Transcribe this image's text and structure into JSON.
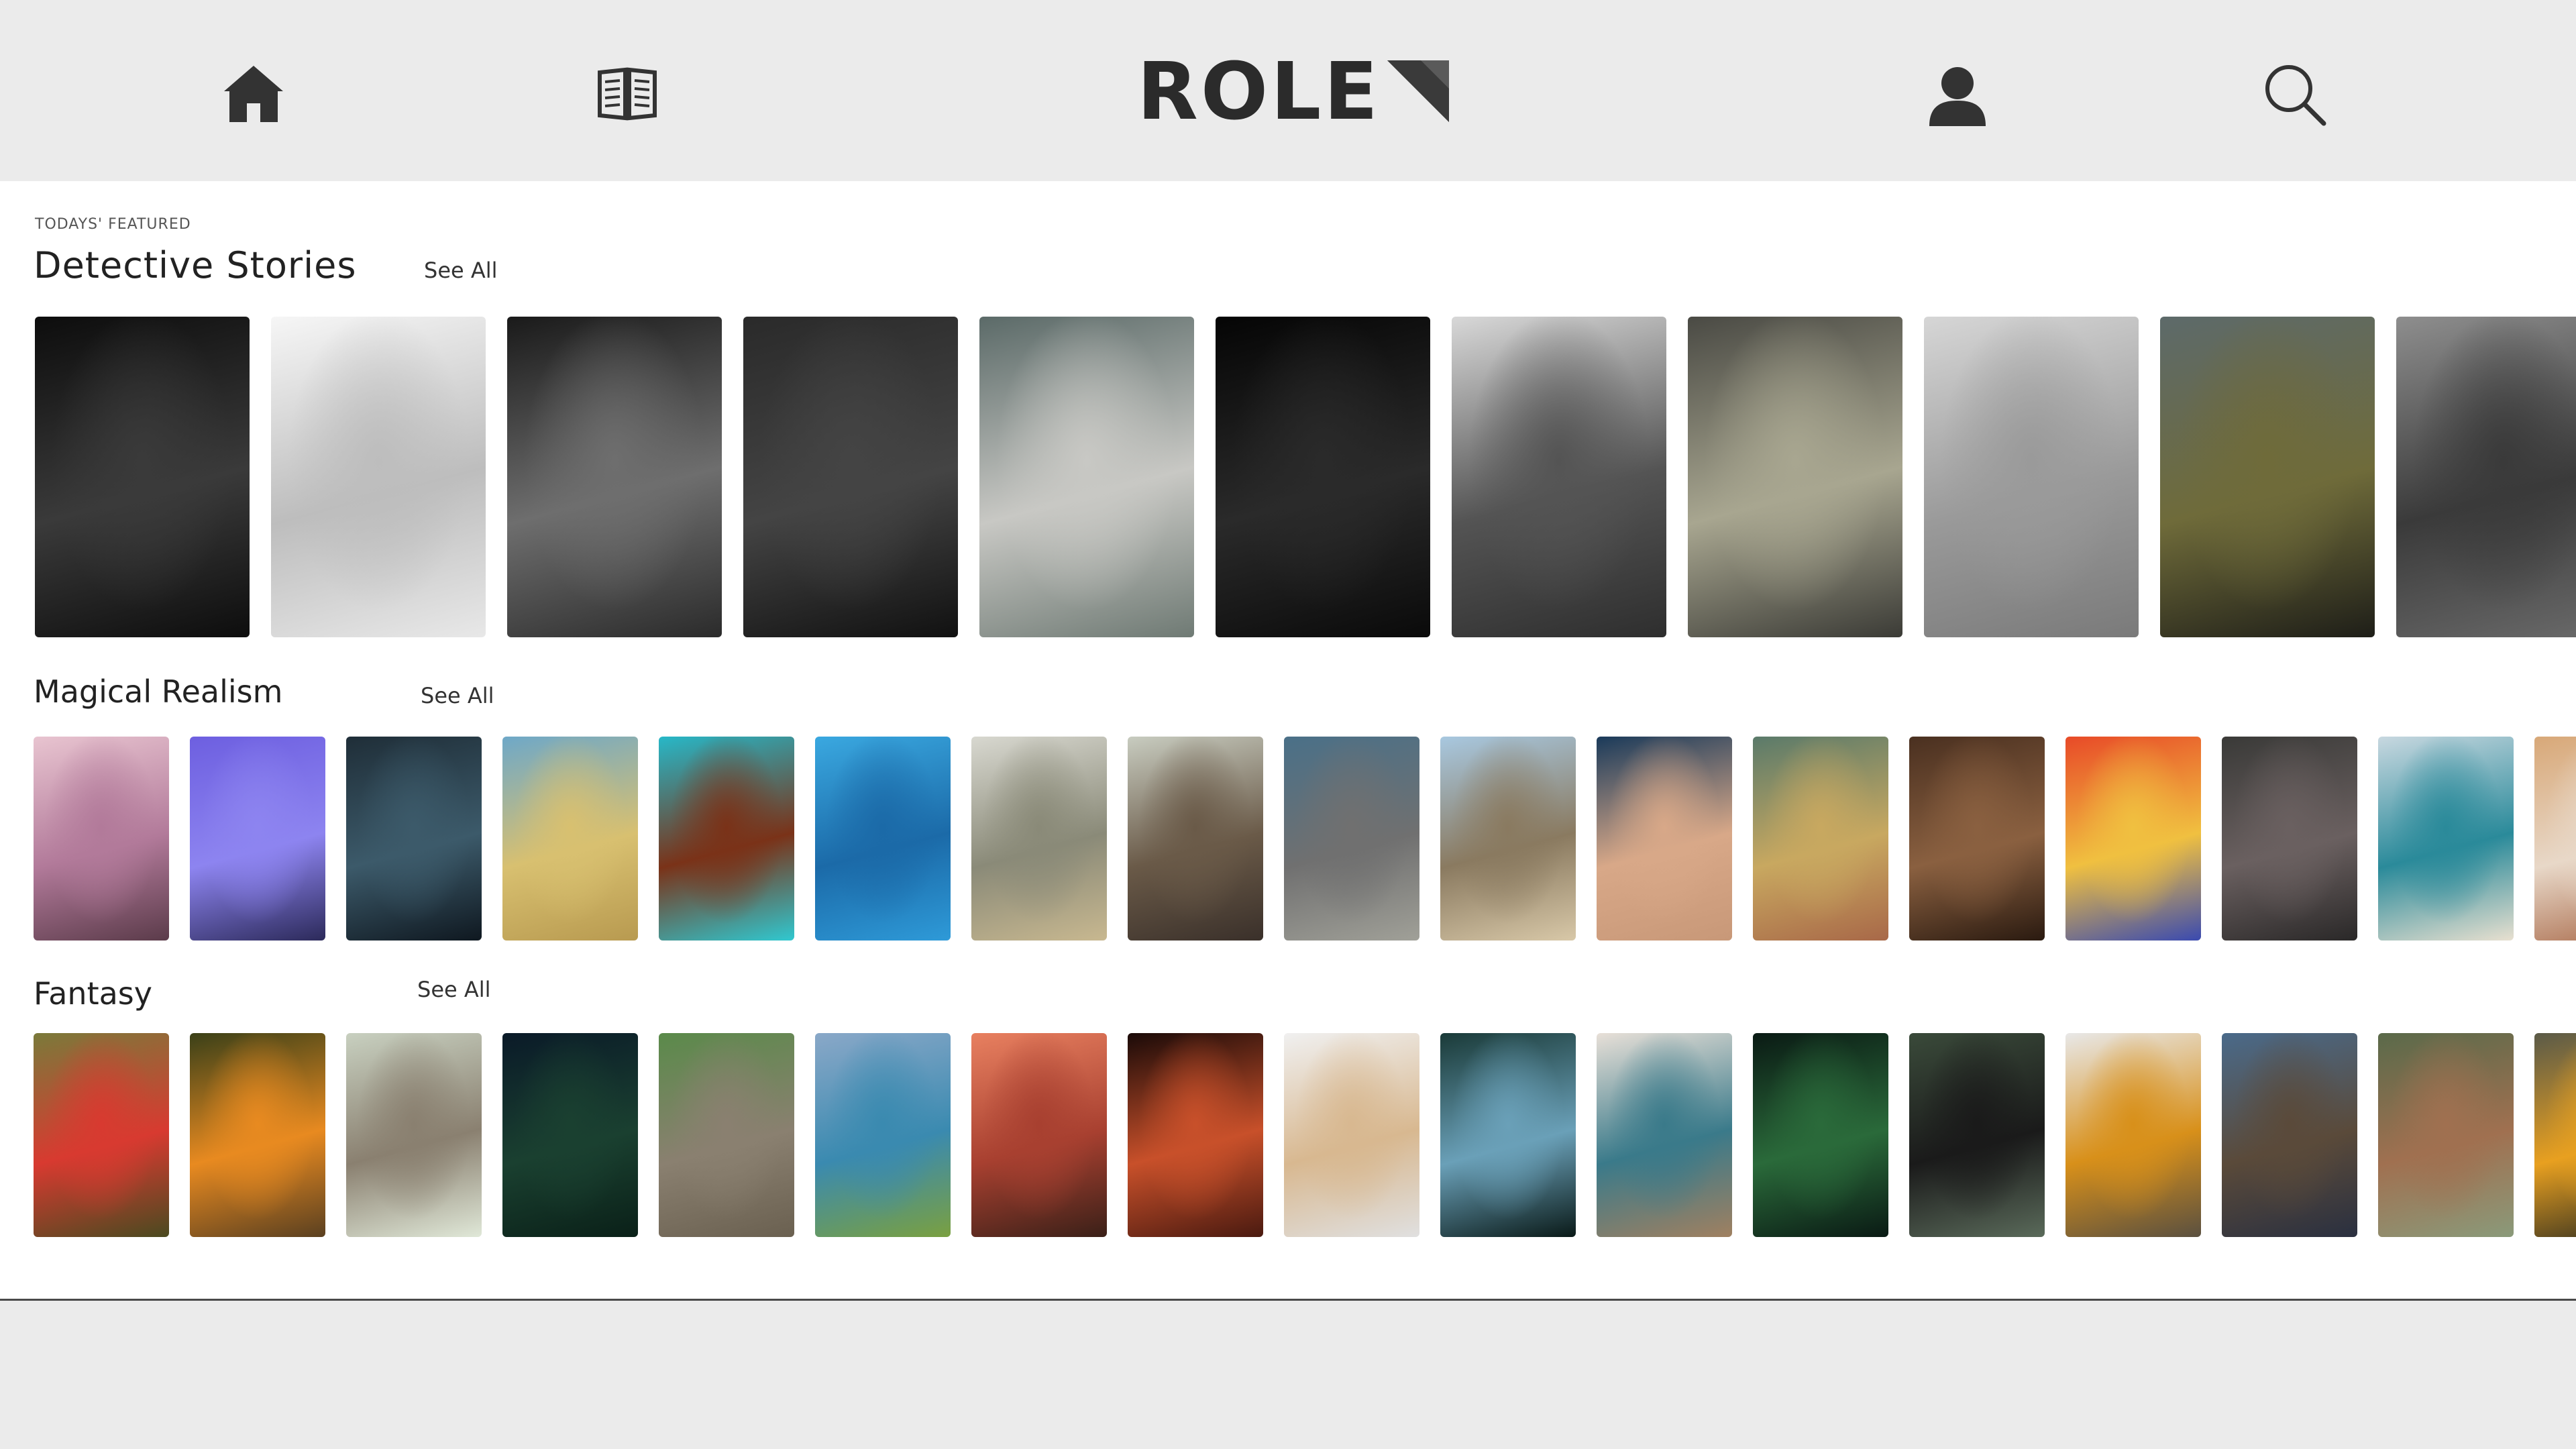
{
  "app": {
    "logo_text": "ROLE",
    "nav": {
      "home_icon": "home-icon",
      "library_icon": "open-book-icon",
      "profile_icon": "user-icon",
      "search_icon": "search-icon"
    },
    "colors": {
      "topbar_bg": "#ebebeb",
      "logo": "#2b2b2b",
      "logo_mark": "#5a5a5a"
    }
  },
  "featured": {
    "kicker": "TODAYS' FEATURED",
    "title": "Detective Stories",
    "see_all": "See All",
    "covers": [
      {
        "name": "parking-lot-figure-cover",
        "colors": [
          "#0d0d0d",
          "#3a3a3a",
          "#0d0d0d"
        ]
      },
      {
        "name": "angel-statue-cover",
        "colors": [
          "#f6f6f6",
          "#bdbdbd",
          "#e8e8e8"
        ]
      },
      {
        "name": "birds-flock-cover",
        "colors": [
          "#1a1a1a",
          "#6e6e6e",
          "#2b2b2b"
        ]
      },
      {
        "name": "coffee-steam-cover",
        "colors": [
          "#2a2a2a",
          "#444444",
          "#111111"
        ]
      },
      {
        "name": "face-in-water-cover",
        "colors": [
          "#5b6a68",
          "#c8c8c4",
          "#6f7a74"
        ]
      },
      {
        "name": "man-profile-dark-cover",
        "colors": [
          "#050505",
          "#2a2a2a",
          "#0a0a0a"
        ]
      },
      {
        "name": "sneakers-tracks-cover",
        "colors": [
          "#d8d8d8",
          "#545454",
          "#2e2e2e"
        ]
      },
      {
        "name": "skyscrapers-up-cover",
        "colors": [
          "#4a4a44",
          "#a8a690",
          "#3b3b36"
        ]
      },
      {
        "name": "street-walker-cover",
        "colors": [
          "#d6d6d6",
          "#9a9a9a",
          "#7a7a7a"
        ]
      },
      {
        "name": "glass-tower-cover",
        "colors": [
          "#5d6a6a",
          "#6f6b3a",
          "#1e1e18"
        ]
      },
      {
        "name": "crowd-cover",
        "colors": [
          "#8e8e8e",
          "#3a3a3a",
          "#6a6a6a"
        ]
      }
    ]
  },
  "magical": {
    "title": "Magical Realism",
    "see_all": "See All",
    "covers": [
      {
        "name": "church-sunrise-cover",
        "colors": [
          "#e8c4d0",
          "#b27a9a",
          "#5b3b4a"
        ]
      },
      {
        "name": "floating-house-cover",
        "colors": [
          "#6d5fe0",
          "#8d84f0",
          "#2c2a5a"
        ]
      },
      {
        "name": "light-streaks-cover",
        "colors": [
          "#1f2e38",
          "#3c5a6a",
          "#0f1820"
        ]
      },
      {
        "name": "sand-castle-cover",
        "colors": [
          "#6ea8c8",
          "#d8c070",
          "#b89a50"
        ]
      },
      {
        "name": "sea-turtle-cover",
        "colors": [
          "#27b8c8",
          "#7a3218",
          "#30c8d0"
        ]
      },
      {
        "name": "dolphin-cover",
        "colors": [
          "#3aa8e0",
          "#1b6aa8",
          "#2e9ad8"
        ]
      },
      {
        "name": "ghost-statue-cover",
        "colors": [
          "#d8d8d0",
          "#8a8a78",
          "#c8b890"
        ]
      },
      {
        "name": "traveler-back-cover",
        "colors": [
          "#c8ccc0",
          "#6a5a48",
          "#3a302a"
        ]
      },
      {
        "name": "iguana-cover",
        "colors": [
          "#4a7088",
          "#707070",
          "#a0a098"
        ]
      },
      {
        "name": "driftwood-cover",
        "colors": [
          "#a8c8e0",
          "#8a7a60",
          "#d8c8a8"
        ]
      },
      {
        "name": "desert-dunes-cover",
        "colors": [
          "#1a3a5a",
          "#d8a888",
          "#c89878"
        ]
      },
      {
        "name": "rainbow-mountains-cover",
        "colors": [
          "#5a7a6a",
          "#c8a860",
          "#a86848"
        ]
      },
      {
        "name": "workshop-shelves-cover",
        "colors": [
          "#4a3020",
          "#8a6040",
          "#2a1a10"
        ]
      },
      {
        "name": "ink-swirl-cover",
        "colors": [
          "#e84a28",
          "#f0c040",
          "#3a4ab0"
        ]
      },
      {
        "name": "string-lights-cover",
        "colors": [
          "#3a3a38",
          "#6a6060",
          "#2a2828"
        ]
      },
      {
        "name": "balcony-building-cover",
        "colors": [
          "#c8d8e0",
          "#2a8a9a",
          "#e8e0d0"
        ]
      },
      {
        "name": "edge-building-cover",
        "colors": [
          "#d8a878",
          "#e8d8c8",
          "#a86848"
        ]
      }
    ]
  },
  "fantasy": {
    "title": "Fantasy",
    "see_all": "See All",
    "covers": [
      {
        "name": "scarlet-ibis-cover",
        "colors": [
          "#7a7a3a",
          "#d83a30",
          "#4a4a20"
        ]
      },
      {
        "name": "forest-path-cover",
        "colors": [
          "#3a4018",
          "#e88a20",
          "#5a4020"
        ]
      },
      {
        "name": "owl-blossoms-cover",
        "colors": [
          "#c8d0c0",
          "#8a8070",
          "#e0e8d8"
        ]
      },
      {
        "name": "moon-forest-cover",
        "colors": [
          "#0a1a28",
          "#1a4030",
          "#0a2018"
        ]
      },
      {
        "name": "stone-faces-cover",
        "colors": [
          "#5a8a4a",
          "#8a8070",
          "#6a6050"
        ]
      },
      {
        "name": "mountain-lake-cover",
        "colors": [
          "#8aa8c8",
          "#3a8ab0",
          "#7aa040"
        ]
      },
      {
        "name": "volcano-sunset-cover",
        "colors": [
          "#e88060",
          "#a84030",
          "#3a2018"
        ]
      },
      {
        "name": "antelope-canyon-cover",
        "colors": [
          "#1a0a08",
          "#c8502a",
          "#4a1a10"
        ]
      },
      {
        "name": "white-horse-cover",
        "colors": [
          "#f0f0f0",
          "#d8b890",
          "#e0e0e0"
        ]
      },
      {
        "name": "woman-forest-cover",
        "colors": [
          "#1a3a38",
          "#6aa0b8",
          "#0a1a18"
        ]
      },
      {
        "name": "river-aerial-cover",
        "colors": [
          "#e8e0d8",
          "#3a7a8a",
          "#a08060"
        ]
      },
      {
        "name": "fern-dark-cover",
        "colors": [
          "#0a1a14",
          "#2a6a3a",
          "#0a1a14"
        ]
      },
      {
        "name": "man-road-cover",
        "colors": [
          "#3a4a3a",
          "#1a1a1a",
          "#5a6a5a"
        ]
      },
      {
        "name": "hiker-yellow-cover",
        "colors": [
          "#e8e8e8",
          "#d8901a",
          "#5a5040"
        ]
      },
      {
        "name": "rocky-peak-cover",
        "colors": [
          "#4a6a8a",
          "#5a4a3a",
          "#2a3040"
        ]
      },
      {
        "name": "grazing-deer-cover",
        "colors": [
          "#5a6a4a",
          "#a07050",
          "#8a9a7a"
        ]
      },
      {
        "name": "toucan-edge-cover",
        "colors": [
          "#5a5a48",
          "#e8a020",
          "#2a2a20"
        ]
      }
    ]
  }
}
